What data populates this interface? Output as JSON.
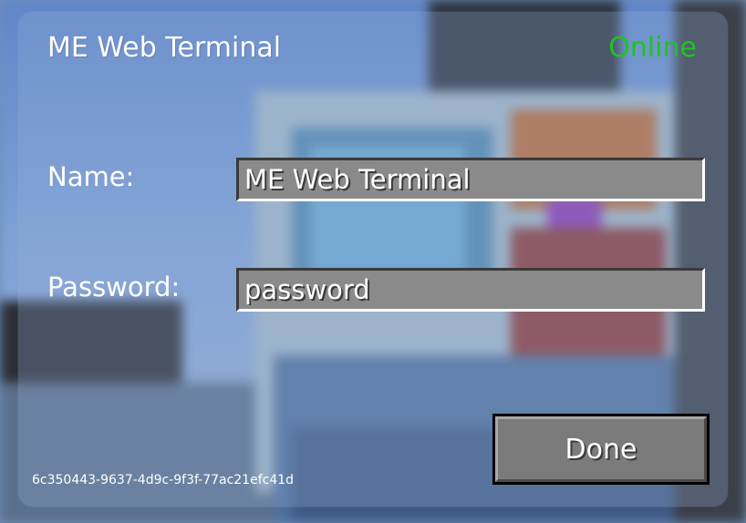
{
  "dialog": {
    "title": "ME Web Terminal",
    "status": "Online",
    "status_color": "#1fc41f",
    "name_label": "Name:",
    "name_value": "ME Web Terminal",
    "password_label": "Password:",
    "password_value": "password",
    "done_label": "Done",
    "uuid": "6c350443-9637-4d9c-9f3f-77ac21efc41d"
  }
}
